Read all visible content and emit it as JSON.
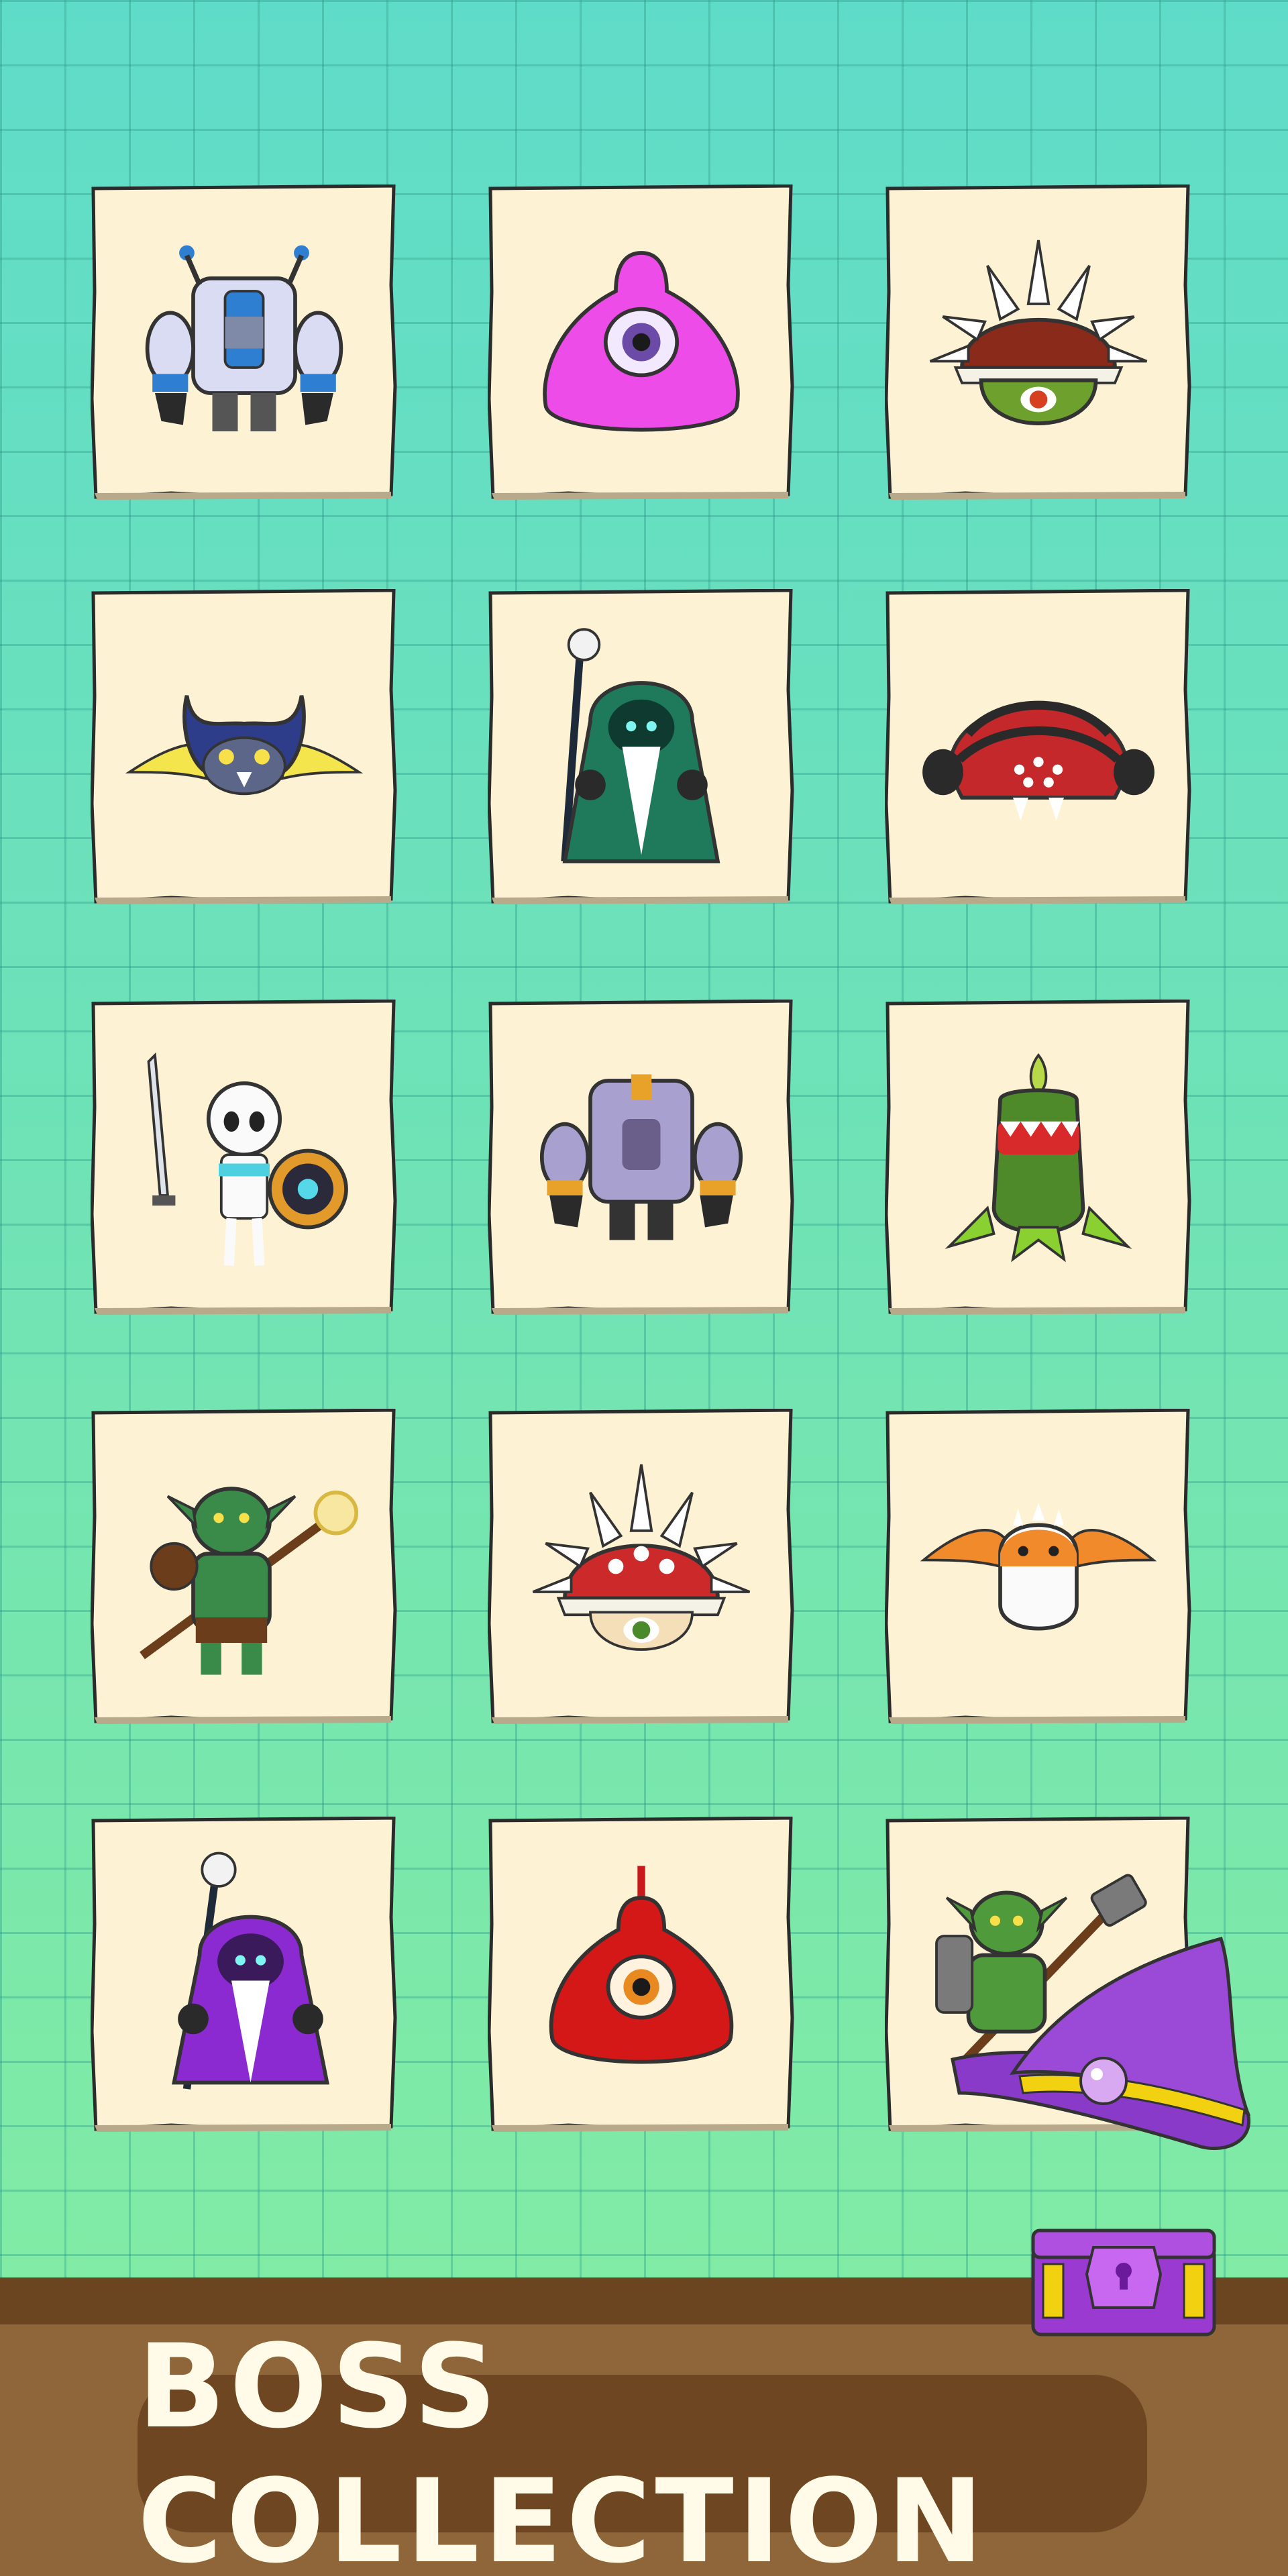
{
  "title": "BOSS COLLECTION",
  "colors": {
    "card_paper": "#fdf3d4",
    "card_outline": "#2b2b2b",
    "ground": "#8f6639",
    "title_text": "#fffbe8"
  },
  "bosses": [
    {
      "row": 1,
      "col": 1,
      "icon": "armored-robot-golem-icon"
    },
    {
      "row": 1,
      "col": 2,
      "icon": "pink-one-eyed-slime-icon"
    },
    {
      "row": 1,
      "col": 3,
      "icon": "spiked-shell-turtle-icon"
    },
    {
      "row": 2,
      "col": 1,
      "icon": "horned-bat-icon"
    },
    {
      "row": 2,
      "col": 2,
      "icon": "green-hooded-wizard-icon"
    },
    {
      "row": 2,
      "col": 3,
      "icon": "red-spider-beetle-icon"
    },
    {
      "row": 3,
      "col": 1,
      "icon": "skeleton-warrior-icon"
    },
    {
      "row": 3,
      "col": 2,
      "icon": "purple-robot-golem-icon"
    },
    {
      "row": 3,
      "col": 3,
      "icon": "carnivorous-plant-icon"
    },
    {
      "row": 4,
      "col": 1,
      "icon": "orc-shaman-icon"
    },
    {
      "row": 4,
      "col": 2,
      "icon": "white-spiked-shell-icon"
    },
    {
      "row": 4,
      "col": 3,
      "icon": "orange-fire-bat-icon"
    },
    {
      "row": 5,
      "col": 1,
      "icon": "purple-hooded-wizard-icon"
    },
    {
      "row": 5,
      "col": 2,
      "icon": "red-one-eyed-slime-icon"
    },
    {
      "row": 5,
      "col": 3,
      "icon": "orc-hammer-warrior-icon"
    }
  ],
  "decor": {
    "chest": "treasure-chest-icon",
    "hat": "wizard-hat-icon"
  }
}
